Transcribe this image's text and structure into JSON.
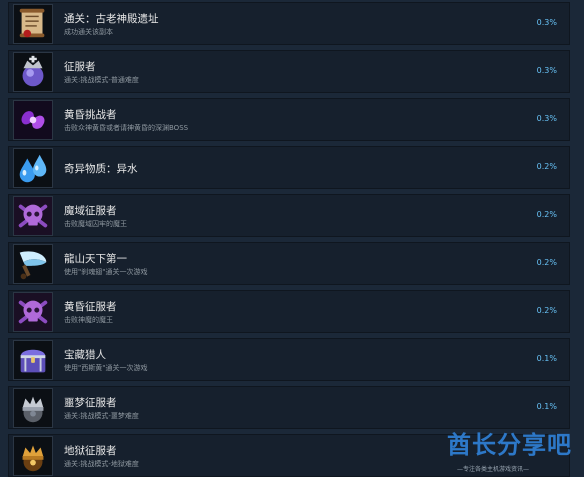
{
  "achievements": [
    {
      "title": "通关：古老神殿遗址",
      "desc": "成功通关该副本",
      "pct": "0.3%",
      "icon": "scroll-icon",
      "color": "#c9a56b"
    },
    {
      "title": "征服者",
      "desc": "通关:挑战模式-普通难度",
      "pct": "0.3%",
      "icon": "crown-orb-icon",
      "color": "#7f6ad0"
    },
    {
      "title": "黄昏挑战者",
      "desc": "击败众神黄昏或者请神黄昏的深渊BOSS",
      "pct": "0.3%",
      "icon": "purple-vortex-icon",
      "color": "#9a3fd8"
    },
    {
      "title": "奇异物质：异水",
      "desc": "",
      "pct": "0.2%",
      "icon": "water-drops-icon",
      "color": "#49a9f2"
    },
    {
      "title": "魔域征服者",
      "desc": "击败魔域囚牢的魔王",
      "pct": "0.2%",
      "icon": "purple-skull-icon",
      "color": "#a45bd3"
    },
    {
      "title": "龍山天下第一",
      "desc": "使用\"刹魂翅\"通关一次游戏",
      "pct": "0.2%",
      "icon": "blade-wing-icon",
      "color": "#9fd7f0"
    },
    {
      "title": "黄昏征服者",
      "desc": "击败神魔的魔王",
      "pct": "0.2%",
      "icon": "purple-skull-icon",
      "color": "#a45bd3"
    },
    {
      "title": "宝藏猎人",
      "desc": "使用\"西斯黄\"通关一次游戏",
      "pct": "0.1%",
      "icon": "treasure-chest-icon",
      "color": "#7a6ee0"
    },
    {
      "title": "噩梦征服者",
      "desc": "通关:挑战模式-噩梦难度",
      "pct": "0.1%",
      "icon": "silver-crown-icon",
      "color": "#b9bec6"
    },
    {
      "title": "地狱征服者",
      "desc": "通关:挑战模式-地狱难度",
      "pct": "",
      "icon": "gold-crown-icon",
      "color": "#d08a2a"
    }
  ],
  "watermark": {
    "main": "酋长分享吧",
    "sub": "—专注各类主机游戏资讯—"
  }
}
